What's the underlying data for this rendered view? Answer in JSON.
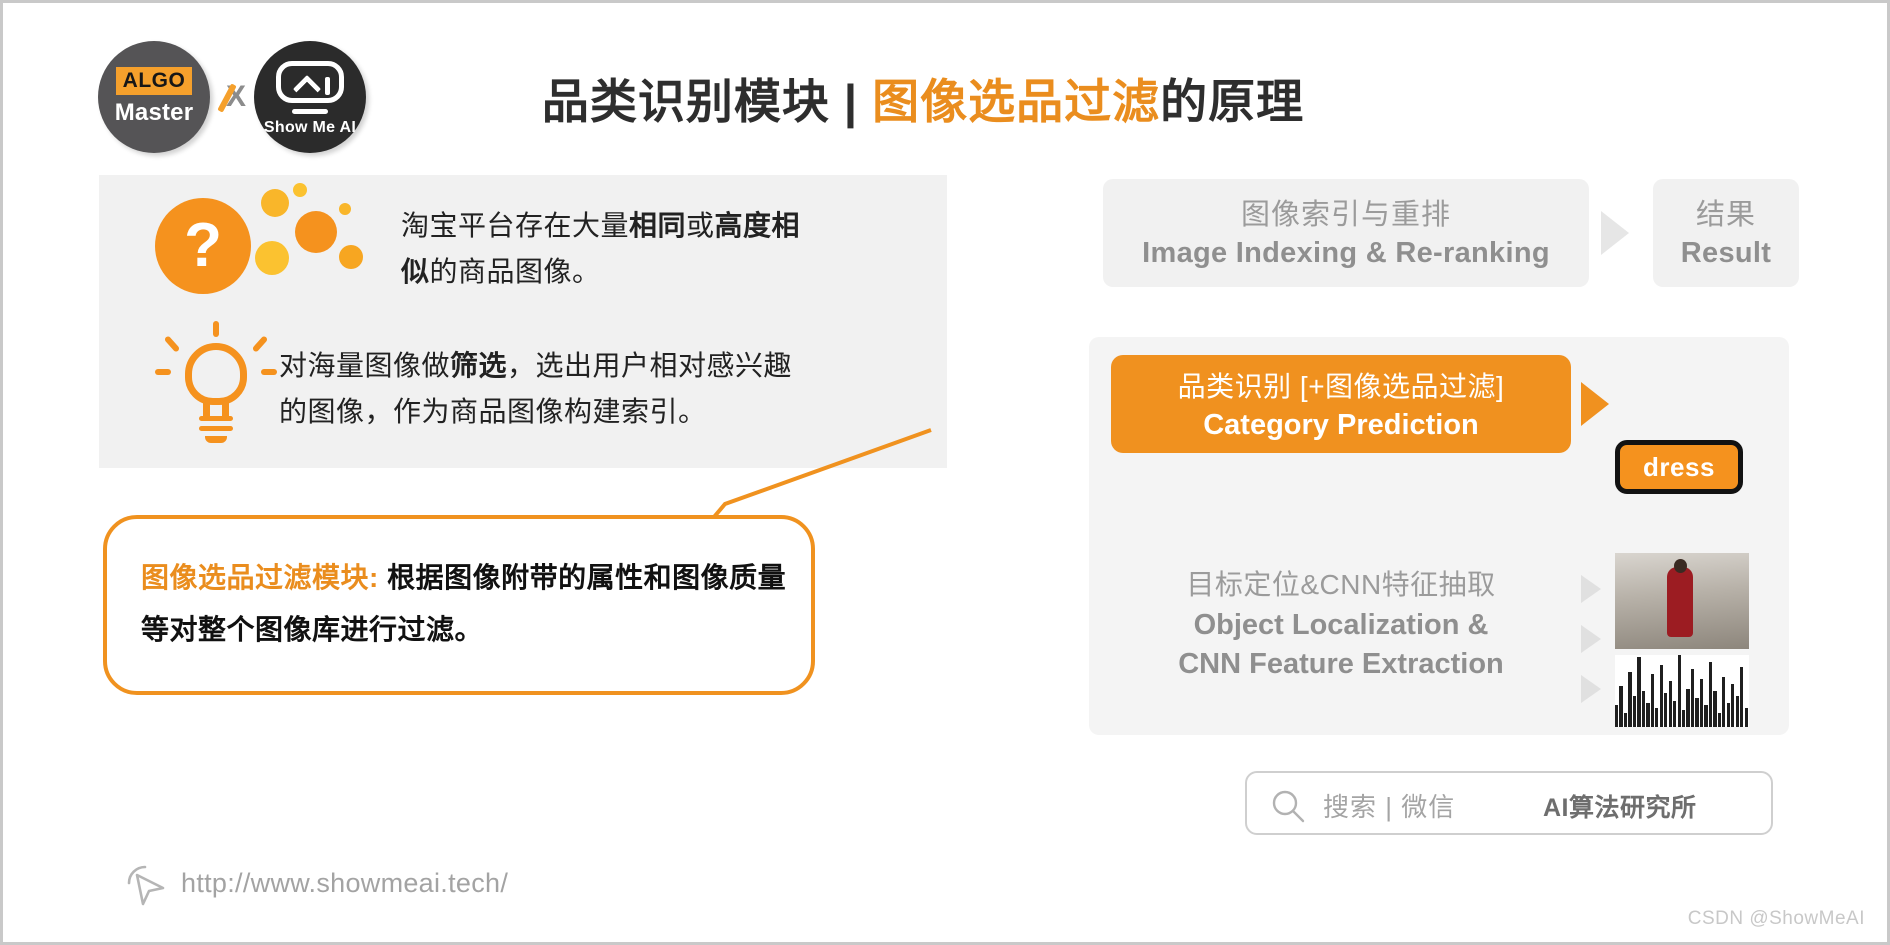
{
  "logo": {
    "algo_badge": "ALGO",
    "algo_name": "Master",
    "cross": "X",
    "showme_name": "Show Me AI"
  },
  "title": {
    "prefix": "品类识别模块 | ",
    "highlight": "图像选品过滤",
    "suffix": "的原理"
  },
  "left_panel": {
    "paragraph_1": {
      "plain_1": "淘宝平台存在大量",
      "bold_1": "相同",
      "plain_2": "或",
      "bold_2": "高度相似",
      "plain_3": "的商品图像。"
    },
    "paragraph_2": {
      "plain_1": "对海量图像做",
      "bold_1": "筛选",
      "plain_2": "，选出用户相对感兴趣的图像，作为商品图像构建索引。"
    },
    "question_glyph": "?"
  },
  "callout": {
    "highlight": "图像选品过滤模块:",
    "body": " 根据图像附带的属性和图像质量等对整个图像库进行过滤。"
  },
  "flow": {
    "indexing_cn": "图像索引与重排",
    "indexing_en": "Image Indexing & Re-ranking",
    "result_cn": "结果",
    "result_en": "Result",
    "category_cn": "品类识别 [+图像选品过滤]",
    "category_en": "Category Prediction",
    "dress_label": "dress",
    "objloc_cn": "目标定位&CNN特征抽取",
    "objloc_en_line1": "Object Localization &",
    "objloc_en_line2": "CNN Feature Extraction"
  },
  "search": {
    "label": "搜索 | 微信",
    "brand": "AI算法研究所"
  },
  "footer": {
    "url": "http://www.showmeai.tech/",
    "watermark": "CSDN @ShowMeAI"
  },
  "colors": {
    "accent_orange": "#f0911f",
    "title_orange": "#ea8d1e",
    "panel_gray": "#f1f1f1",
    "text_gray": "#9b9b9b"
  },
  "histogram": {
    "bars": [
      18,
      34,
      12,
      46,
      26,
      58,
      30,
      20,
      44,
      16,
      52,
      28,
      38,
      22,
      60,
      14,
      32,
      48,
      24,
      40,
      18,
      54,
      30,
      12,
      42,
      20,
      36,
      26,
      50,
      16
    ]
  }
}
